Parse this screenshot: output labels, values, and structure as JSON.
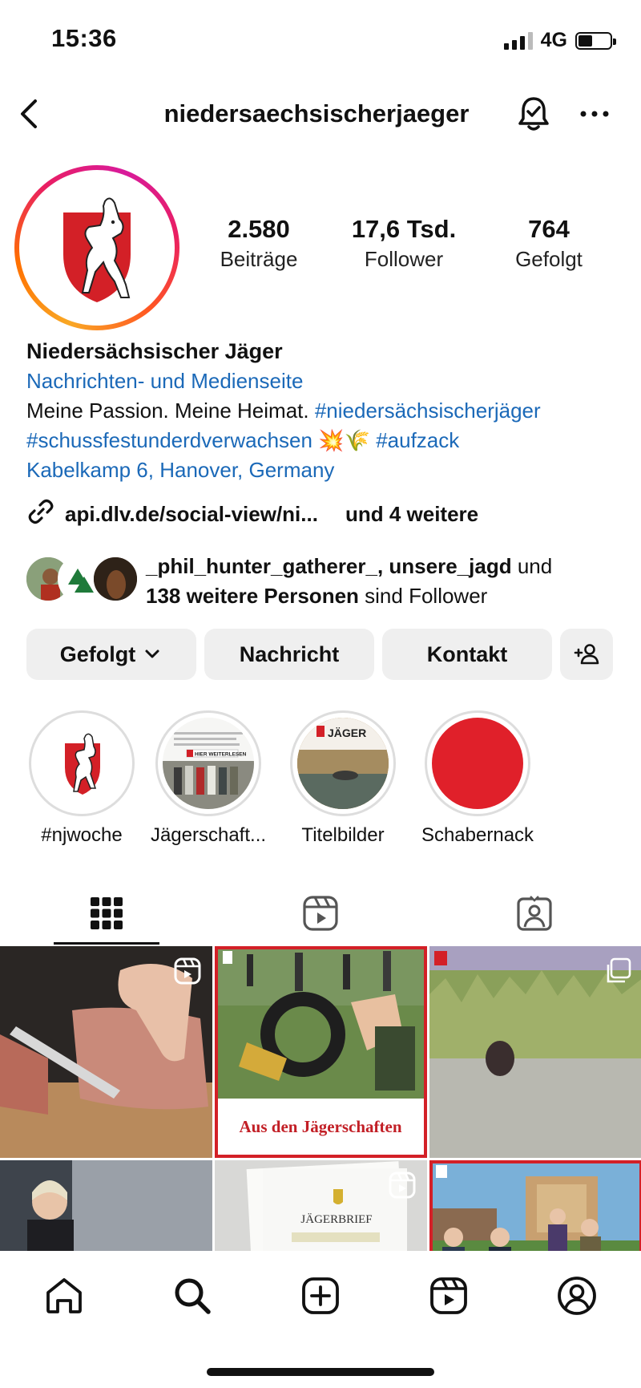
{
  "status_bar": {
    "time": "15:36",
    "network": "4G"
  },
  "header": {
    "username": "niedersaechsischerjaeger"
  },
  "stats": [
    {
      "value": "2.580",
      "label": "Beiträge"
    },
    {
      "value": "17,6 Tsd.",
      "label": "Follower"
    },
    {
      "value": "764",
      "label": "Gefolgt"
    }
  ],
  "bio": {
    "name": "Niedersächsischer Jäger",
    "category": "Nachrichten- und Medienseite",
    "line1_text": "Meine Passion. Meine Heimat.",
    "line1_tag": "#niedersächsischerjäger",
    "line2_tag": "#schussfestunderdverwachsen",
    "line2_emoji": "💥🌾",
    "line2_tag2": "#aufzack",
    "address": "Kabelkamp 6, Hanover, Germany"
  },
  "link": {
    "url": "api.dlv.de/social-view/ni...",
    "more": "und 4 weitere"
  },
  "followed_by": {
    "names": "_phil_hunter_gatherer_, unsere_jagd",
    "and": "und",
    "others": "138 weitere Personen",
    "suffix": "sind Follower"
  },
  "buttons": {
    "following": "Gefolgt",
    "message": "Nachricht",
    "contact": "Kontakt"
  },
  "highlights": [
    {
      "label": "#njwoche"
    },
    {
      "label": "Jägerschaft..."
    },
    {
      "label": "Titelbilder"
    },
    {
      "label": "Schabernack"
    }
  ],
  "highlight_snippets": {
    "paper_button": "HIER WEITERLESEN",
    "cover_logo": "JÄGER"
  },
  "grid_posts": {
    "post2_caption": "Aus den Jägerschaften",
    "post5_text": "JÄGERBRIEF"
  },
  "colors": {
    "link_blue": "#1b69b8",
    "brand_red": "#d32027",
    "button_bg": "#efefef"
  }
}
